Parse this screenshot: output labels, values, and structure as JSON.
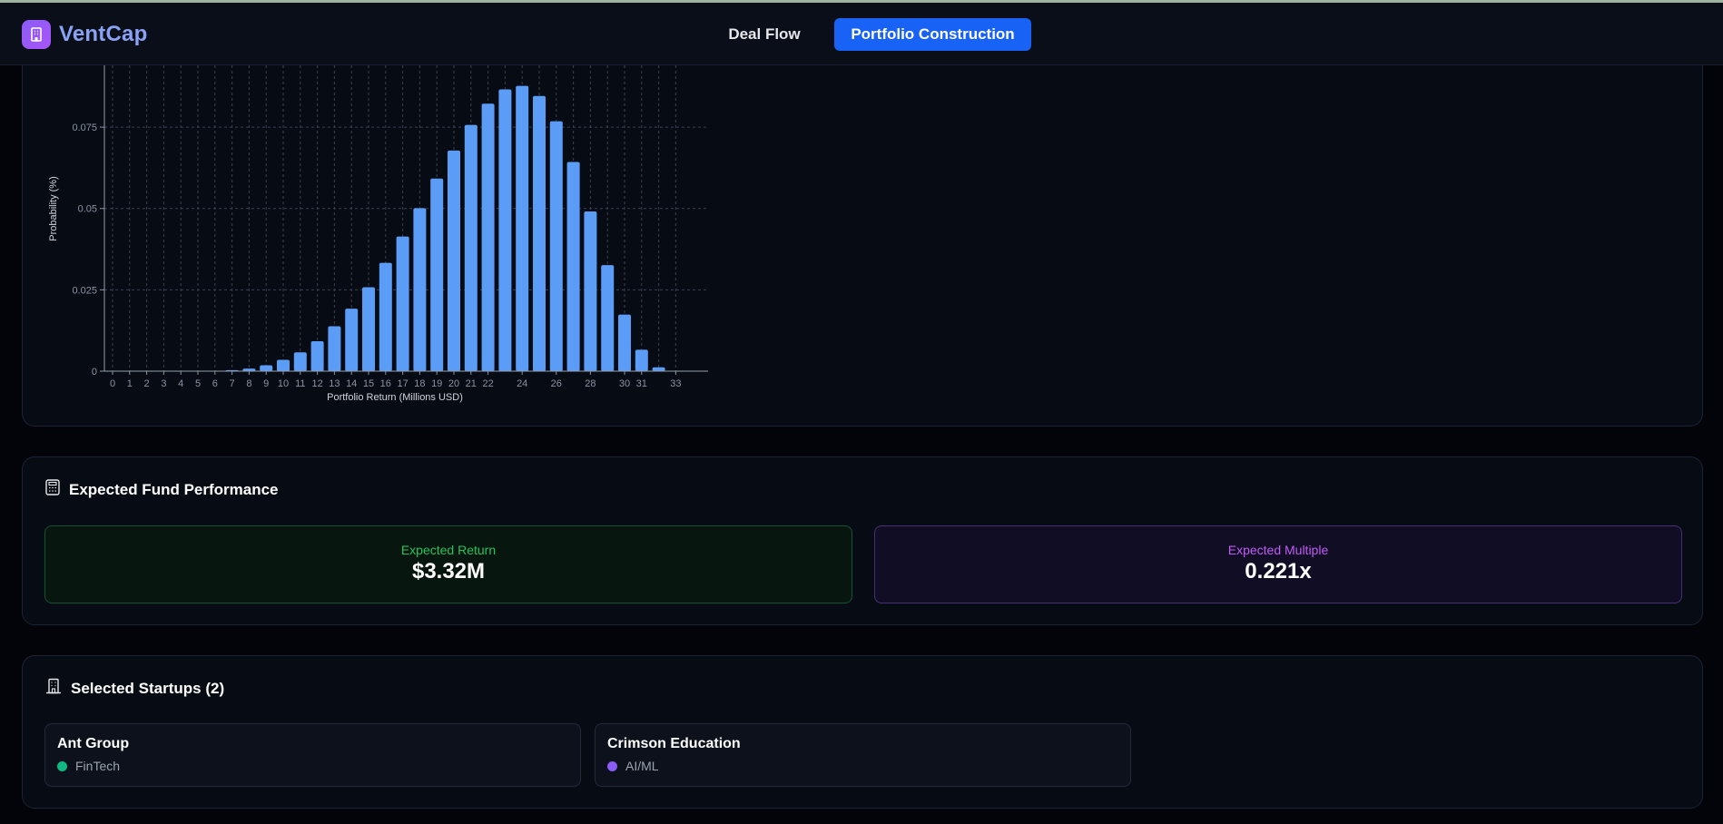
{
  "nav": {
    "brand": "VentCap",
    "tabs": [
      {
        "label": "Deal Flow",
        "active": false
      },
      {
        "label": "Portfolio Construction",
        "active": true
      }
    ]
  },
  "chart_data": {
    "type": "bar",
    "xlabel": "Portfolio Return (Millions USD)",
    "ylabel": "Probability (%)",
    "categories": [
      "0",
      "1",
      "2",
      "3",
      "4",
      "5",
      "6",
      "7",
      "8",
      "9",
      "10",
      "11",
      "12",
      "13",
      "14",
      "15",
      "16",
      "17",
      "18",
      "19",
      "20",
      "21",
      "22",
      "23",
      "24",
      "25",
      "26",
      "27",
      "28",
      "29",
      "30",
      "31",
      "32",
      "33"
    ],
    "tick_labels": [
      "0",
      "1",
      "2",
      "3",
      "4",
      "5",
      "6",
      "7",
      "8",
      "9",
      "10",
      "11",
      "12",
      "13",
      "14",
      "15",
      "16",
      "17",
      "18",
      "19",
      "20",
      "21",
      "22",
      "24",
      "26",
      "28",
      "30",
      "31",
      "33"
    ],
    "values": [
      0,
      0,
      0,
      0,
      0,
      0,
      0,
      0.0003,
      0.0008,
      0.0018,
      0.0035,
      0.0058,
      0.0092,
      0.0138,
      0.0192,
      0.0258,
      0.0333,
      0.0414,
      0.0501,
      0.0592,
      0.0678,
      0.0757,
      0.0822,
      0.0866,
      0.0877,
      0.0846,
      0.0768,
      0.0643,
      0.0491,
      0.0326,
      0.0174,
      0.0066,
      0.0012,
      0
    ],
    "ylim": [
      0,
      0.094
    ],
    "yticks": [
      "0",
      "0.025",
      "0.05",
      "0.075"
    ],
    "grid": true,
    "bar_color": "#5b9cf6"
  },
  "performance": {
    "title": "Expected Fund Performance",
    "expected_return": {
      "label": "Expected Return",
      "value": "$3.32M"
    },
    "expected_multiple": {
      "label": "Expected Multiple",
      "value": "0.221x"
    }
  },
  "startups": {
    "title": "Selected Startups (2)",
    "items": [
      {
        "name": "Ant Group",
        "sector": "FinTech",
        "color": "#10b981"
      },
      {
        "name": "Crimson Education",
        "sector": "AI/ML",
        "color": "#8b5cf6"
      }
    ]
  }
}
